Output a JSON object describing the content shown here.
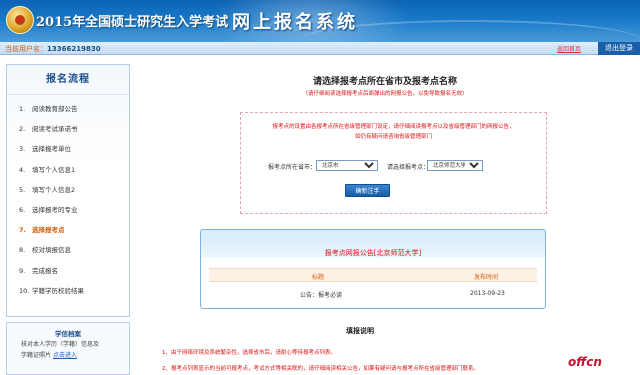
{
  "header": {
    "title": "2015年全国硕士研究生入学考试",
    "system_name": "网上报名系统"
  },
  "userbar": {
    "user_label": "当前用户名：",
    "user_value": "13366219830",
    "help_link": "返回首页",
    "logout_label": "退出登录"
  },
  "sidebar": {
    "title": "报名流程",
    "items": [
      {
        "num": "1.",
        "label": "阅读教育部公告",
        "active": false
      },
      {
        "num": "2.",
        "label": "阅读考试承诺书",
        "active": false
      },
      {
        "num": "3.",
        "label": "选择报考单位",
        "active": false
      },
      {
        "num": "4.",
        "label": "填写个人信息1",
        "active": false
      },
      {
        "num": "5.",
        "label": "填写个人信息2",
        "active": false
      },
      {
        "num": "6.",
        "label": "选择报考的专业",
        "active": false
      },
      {
        "num": "7.",
        "label": "选择报考点",
        "active": true
      },
      {
        "num": "8.",
        "label": "校对填报信息",
        "active": false
      },
      {
        "num": "9.",
        "label": "完成报名",
        "active": false
      },
      {
        "num": "10.",
        "label": "学籍学历校验结果",
        "active": false
      }
    ]
  },
  "note": {
    "title": "学信档案",
    "line1": "核对本人学历（学籍）信息及",
    "line2_prefix": "学籍证照片",
    "link": "点击进入"
  },
  "main": {
    "heading": "请选择报考点所在省市及报考点名称",
    "subheading": "（请仔细阅读选择报考点后面弹出的网报公告，以免导致报名无效）"
  },
  "selector": {
    "warning_line1": "报考点的设置由各报考点所在省级管理部门设定，请仔细阅读报考点以及省级管理部门的网报公告，",
    "warning_line2": "如仍有疑问请咨询省级管理部门",
    "province_label": "报考点所在省市：",
    "province_value": "北京市",
    "site_label": "请选择报考点：",
    "site_value": "北京师范大学",
    "confirm_label": "确新注手"
  },
  "announcement": {
    "title": "报考点网报公告[北京师范大学]",
    "col_title": "标题",
    "col_date": "发布时间",
    "rows": [
      {
        "title": "公告：报考必读",
        "date": "2013-09-23"
      }
    ]
  },
  "fill_notes": {
    "title": "填报说明",
    "items": [
      "1、由于网络环境及系统繁杂性，选择省市后，请耐心等待报考点列表。",
      "2、报考点列表显示的当前可报考点，考试方式等相关联的，请仔细阅读相关公告，如果有疑问请与报考点所在省级管理部门联系。"
    ]
  },
  "watermark": "offcn",
  "colors": {
    "banner_blue": "#1878c8",
    "accent_orange": "#d35d0b",
    "warning_red": "#d11111",
    "button_blue": "#155ea8"
  }
}
